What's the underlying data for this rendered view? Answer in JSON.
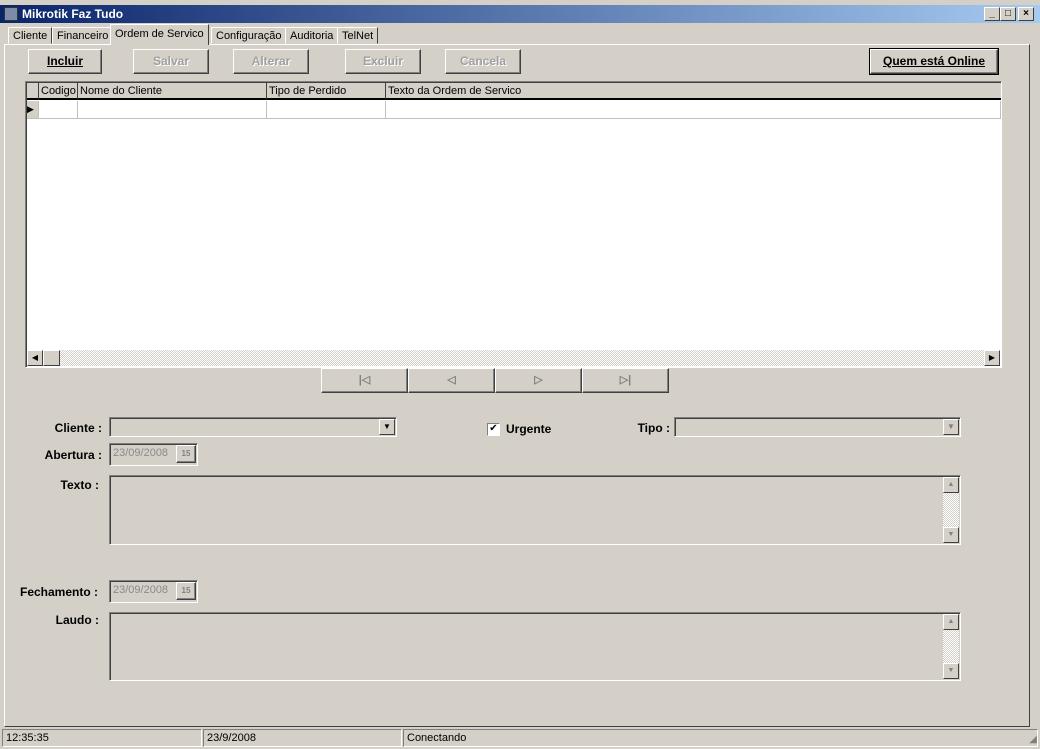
{
  "window": {
    "title": "Mikrotik Faz Tudo",
    "min": "_",
    "max": "□",
    "close": "×"
  },
  "tabs": [
    "Cliente",
    "Financeiro",
    "Ordem de Servico",
    "Configuração",
    "Auditoria",
    "TelNet"
  ],
  "toolbar": {
    "incluir": "Incluir",
    "salvar": "Salvar",
    "alterar": "Alterar",
    "excluir": "Excluir",
    "cancela": "Cancela",
    "online": "Quem está Online"
  },
  "grid": {
    "columns": [
      "Codigo",
      "Nome do Cliente",
      "Tipo de Perdido",
      "Texto da Ordem de Servico"
    ]
  },
  "navigator": {
    "first": "|◁",
    "prior": "◁",
    "next": "▷",
    "last": "▷|"
  },
  "form": {
    "cliente_label": "Cliente :",
    "urgente_label": "Urgente",
    "urgente_checked": true,
    "tipo_label": "Tipo :",
    "abertura_label": "Abertura :",
    "abertura_value": "23/09/2008",
    "texto_label": "Texto :",
    "fechamento_label": "Fechamento :",
    "fechamento_value": "23/09/2008",
    "laudo_label": "Laudo :",
    "cal_icon": "15"
  },
  "status": {
    "time": "12:35:35",
    "date": "23/9/2008",
    "connection": "Conectando"
  }
}
